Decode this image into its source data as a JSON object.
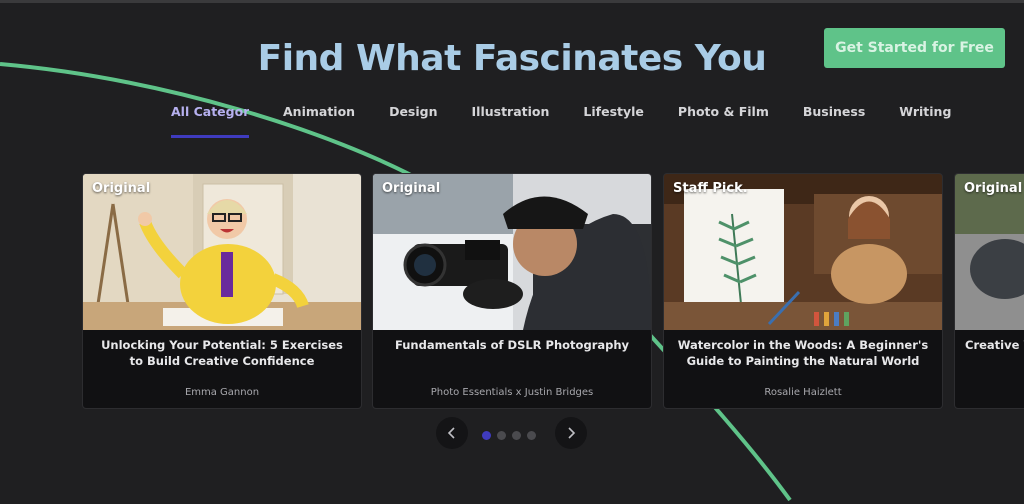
{
  "header": {
    "title": "Find What Fascinates You",
    "cta_label": "Get Started for Free"
  },
  "tabs": [
    {
      "label": "All Categories",
      "active": true
    },
    {
      "label": "Animation"
    },
    {
      "label": "Design"
    },
    {
      "label": "Illustration"
    },
    {
      "label": "Lifestyle"
    },
    {
      "label": "Photo & Film"
    },
    {
      "label": "Business"
    },
    {
      "label": "Writing"
    }
  ],
  "cards": [
    {
      "badge": "Original",
      "title": "Unlocking Your Potential: 5 Exercises to Build Creative Confidence",
      "author": "Emma Gannon"
    },
    {
      "badge": "Original",
      "title": "Fundamentals of DSLR Photography",
      "author": "Photo Essentials x Justin Bridges"
    },
    {
      "badge": "Staff Pick.",
      "title": "Watercolor in the Woods: A Beginner's Guide to Painting the Natural World",
      "author": "Rosalie Haizlett"
    },
    {
      "badge": "Original",
      "title": "Creative Wr",
      "author": ""
    }
  ],
  "carousel": {
    "pages": 4,
    "active_page": 1,
    "prev_icon": "chevron-left-icon",
    "next_icon": "chevron-right-icon"
  },
  "colors": {
    "background": "#1f1f21",
    "title": "#a9cce6",
    "cta": "#5fc389",
    "accent": "#3f3bbf",
    "decor_curve": "#5fc389"
  }
}
